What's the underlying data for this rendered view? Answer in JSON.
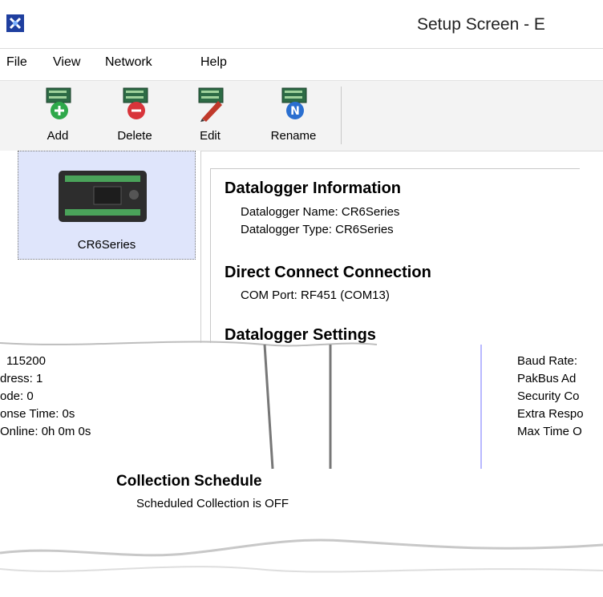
{
  "window": {
    "title": "Setup Screen - E"
  },
  "menu": [
    "File",
    "View",
    "Network",
    "Help"
  ],
  "toolbar": {
    "add": "Add",
    "delete": "Delete",
    "edit": "Edit",
    "rename": "Rename"
  },
  "device_list": [
    {
      "name": "CR6Series"
    }
  ],
  "info": {
    "datalogger_heading": "Datalogger Information",
    "datalogger_name": "Datalogger Name: CR6Series",
    "datalogger_type": "Datalogger Type: CR6Series",
    "connection_heading": "Direct Connect Connection",
    "com_port": "COM Port: RF451 (COM13)",
    "settings_heading": "Datalogger Settings",
    "settings_values_left": [
      "115200",
      "dress: 1",
      "ode: 0",
      "onse Time: 0s",
      "Online: 0h 0m 0s"
    ],
    "settings_labels_right": [
      "Baud Rate:",
      "PakBus Ad",
      "Security Co",
      "Extra Respo",
      "Max Time O"
    ],
    "collection_heading": "Collection Schedule",
    "collection_status": "Scheduled Collection is OFF"
  },
  "colors": {
    "selection": "#dfe5fb",
    "toolbar_bg": "#f3f3f3",
    "add_green": "#2ea84a",
    "delete_red": "#d8343a",
    "rename_blue": "#2a6fd0",
    "app_icon_blue": "#1f3f9f"
  }
}
